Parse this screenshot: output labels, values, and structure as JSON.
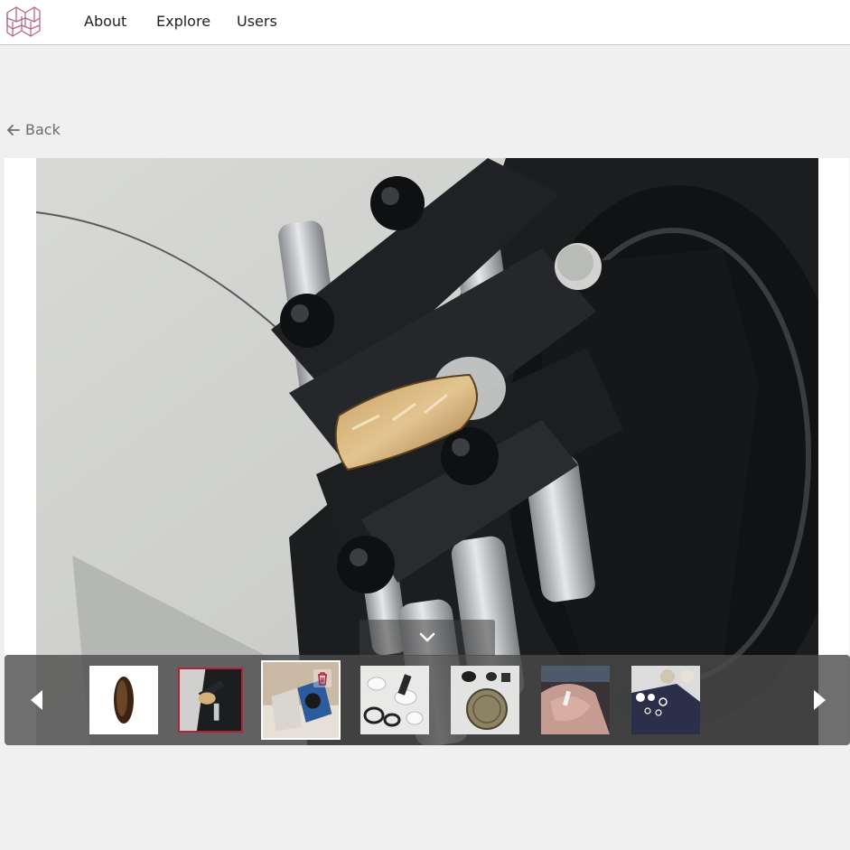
{
  "nav": {
    "logo_icon": "lattice-cube-logo",
    "links": [
      "About",
      "Explore",
      "Users"
    ]
  },
  "back": {
    "label": "Back",
    "icon": "arrow-left-icon"
  },
  "viewer": {
    "photo_description_icon": "ring-holder-photo",
    "collapse_icon": "chevron-down-icon"
  },
  "thumbnails": {
    "prev_icon": "caret-left-icon",
    "next_icon": "caret-right-icon",
    "delete_icon": "trash-icon",
    "selected_index": 1,
    "hovered_index": 2,
    "count": 7,
    "accent_selected": "#b0243a"
  },
  "colors": {
    "logo": "#b7668a",
    "page_bg": "#f0f0f0",
    "strip_bg": "#4b4b4b"
  }
}
